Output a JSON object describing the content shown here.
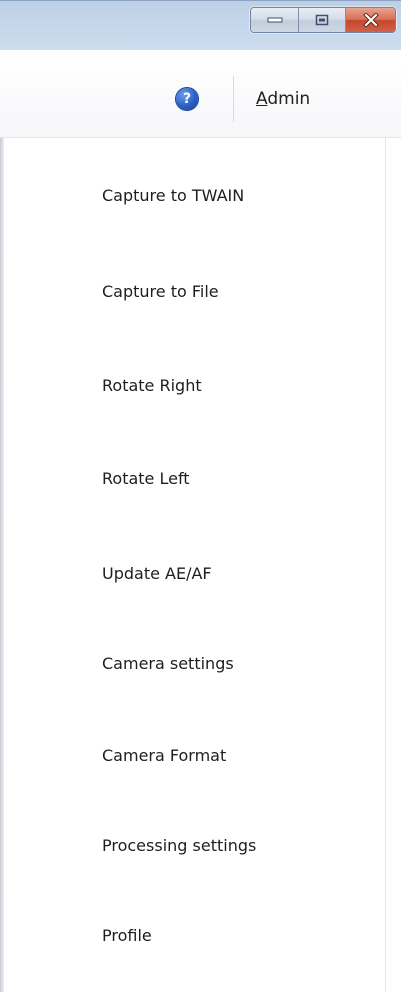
{
  "window": {
    "minimize_label": "Minimize",
    "maximize_label": "Maximize",
    "close_label": "Close",
    "close_color": "#c5472a"
  },
  "header": {
    "help_glyph": "?",
    "admin_first": "A",
    "admin_rest": "dmin"
  },
  "menu": {
    "items": [
      {
        "label": "Capture to TWAIN"
      },
      {
        "label": "Capture to File"
      },
      {
        "label": "Rotate Right"
      },
      {
        "label": "Rotate Left"
      },
      {
        "label": "Update AE/AF"
      },
      {
        "label": "Camera settings"
      },
      {
        "label": "Camera Format"
      },
      {
        "label": "Processing settings"
      },
      {
        "label": "Profile"
      }
    ]
  }
}
